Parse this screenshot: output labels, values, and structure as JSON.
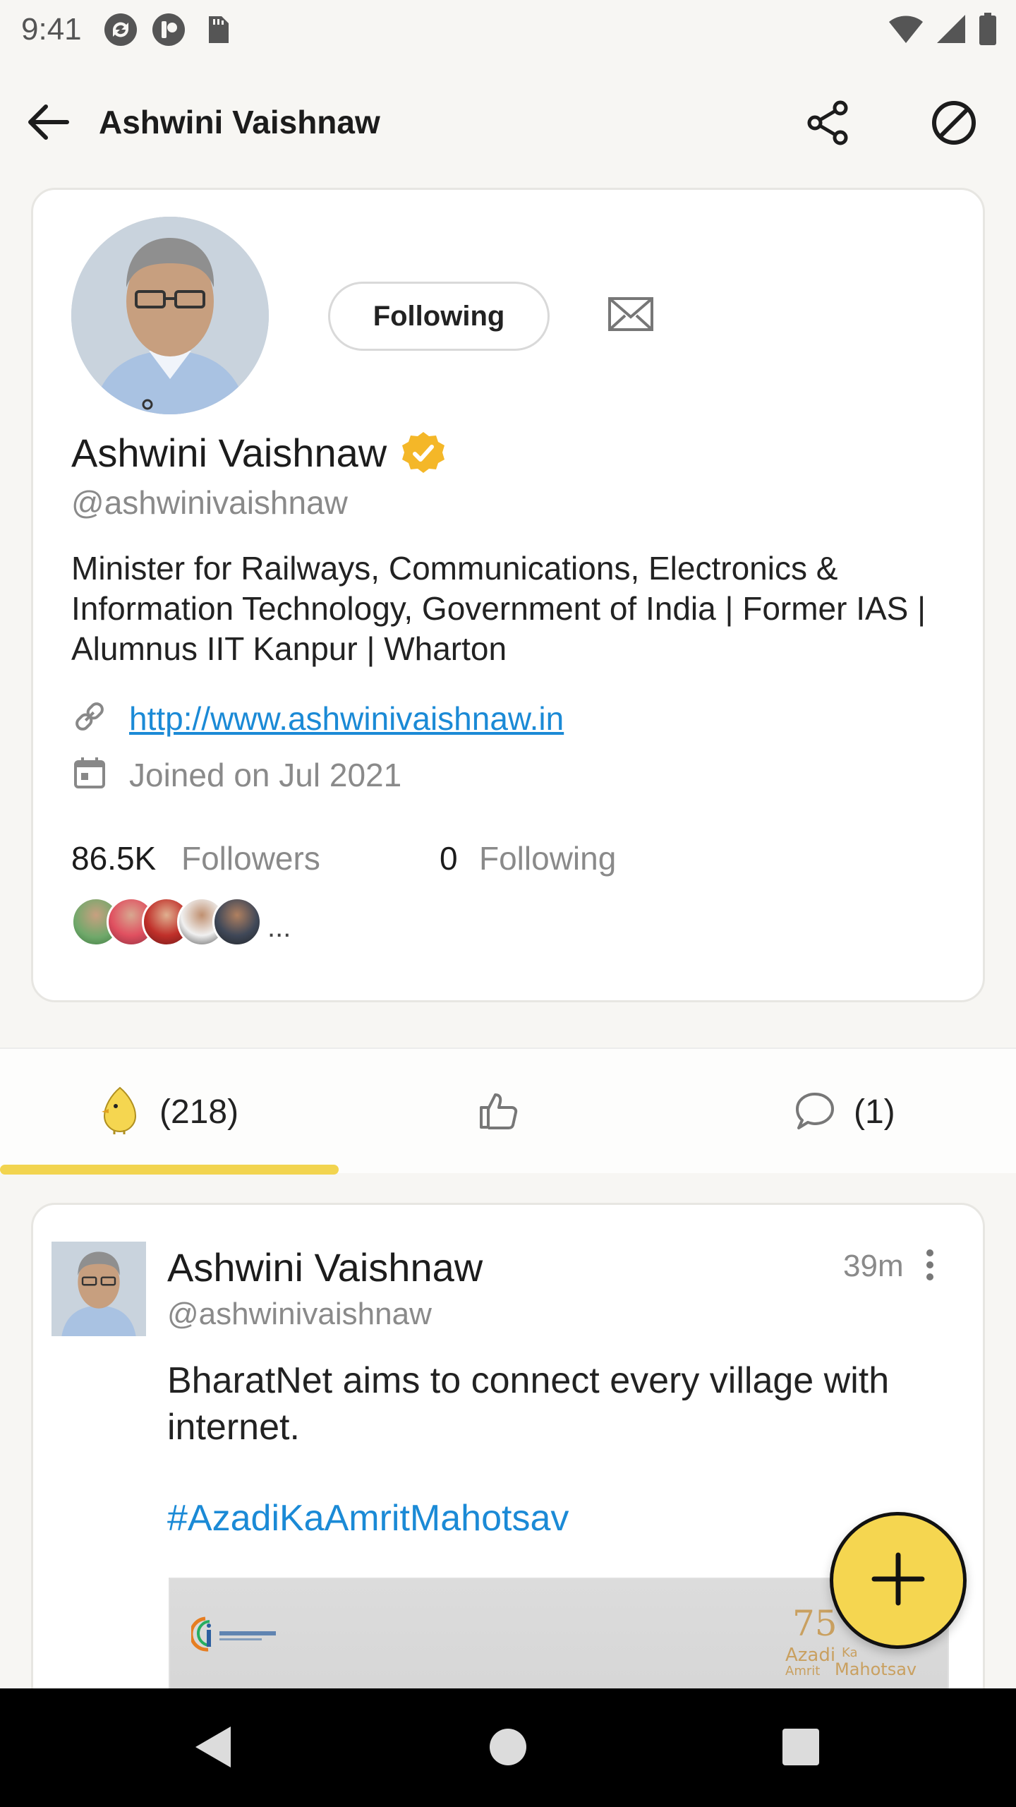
{
  "status_bar": {
    "time": "9:41",
    "icons": [
      "sync-icon",
      "app-notification-icon",
      "sd-card-icon",
      "wifi-icon",
      "signal-icon",
      "battery-icon"
    ]
  },
  "app_bar": {
    "title": "Ashwini Vaishnaw",
    "icons": [
      "back-arrow-icon",
      "share-icon",
      "block-icon"
    ]
  },
  "profile": {
    "follow_button_label": "Following",
    "name": "Ashwini Vaishnaw",
    "handle": "@ashwinivaishnaw",
    "bio": "Minister for Railways, Communications, Electronics & Information Technology, Government of India | Former IAS | Alumnus IIT Kanpur | Wharton",
    "website": "http://www.ashwinivaishnaw.in",
    "joined": "Joined on Jul 2021",
    "followers_count": "86.5K",
    "followers_label": "Followers",
    "following_count": "0",
    "following_label": "Following",
    "more_followers": "..."
  },
  "tabs": [
    {
      "label": "(218)",
      "icon": "koo-bird-icon",
      "active": true
    },
    {
      "label": "",
      "icon": "thumbs-up-icon",
      "active": false
    },
    {
      "label": "(1)",
      "icon": "comment-icon",
      "active": false
    }
  ],
  "post": {
    "author": "Ashwini Vaishnaw",
    "handle": "@ashwinivaishnaw",
    "time": "39m",
    "text": "BharatNet aims to connect every village with internet.",
    "hashtag": "#AzadiKaAmritMahotsav"
  },
  "colors": {
    "accent_yellow": "#f5d650",
    "link_blue": "#1b8ad6",
    "verified_badge": "#f4b728"
  }
}
